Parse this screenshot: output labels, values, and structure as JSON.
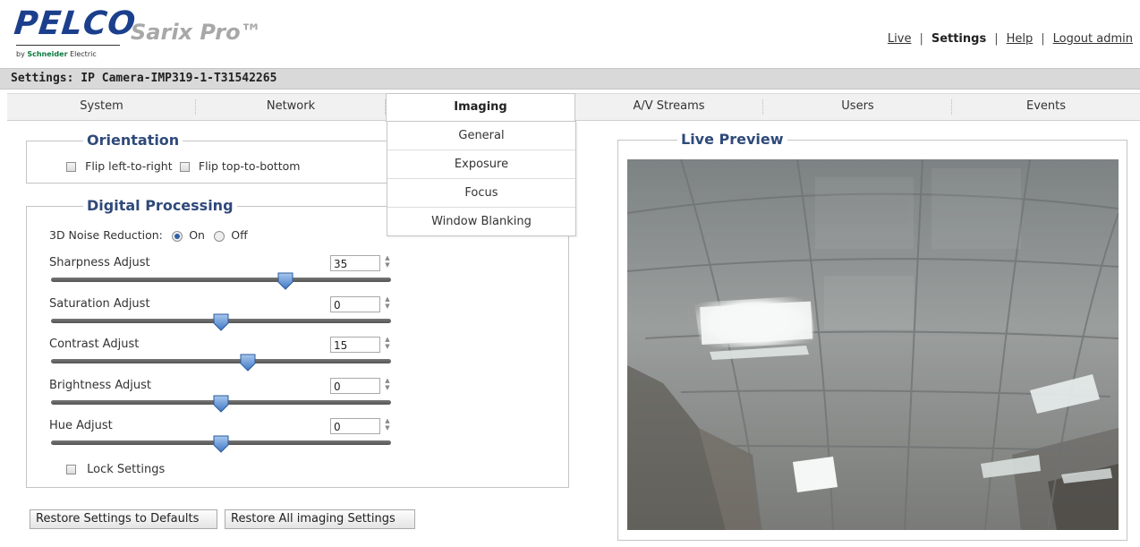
{
  "header": {
    "brand": "PELCO",
    "product": "Sarix Pro™",
    "byline_prefix": "by",
    "byline_brand": "Schneider",
    "byline_suffix": "Electric",
    "links": {
      "live": "Live",
      "settings": "Settings",
      "help": "Help",
      "logout": "Logout admin",
      "separator": "|"
    }
  },
  "titlebar": {
    "text": "Settings: IP Camera-IMP319-1-T31542265"
  },
  "tabs": [
    "System",
    "Network",
    "Imaging",
    "A/V Streams",
    "Users",
    "Events"
  ],
  "active_tab": "Imaging",
  "dropdown": [
    "General",
    "Exposure",
    "Focus",
    "Window Blanking"
  ],
  "orientation": {
    "legend": "Orientation",
    "flip_lr": "Flip left-to-right",
    "flip_tb": "Flip top-to-bottom",
    "flip_lr_checked": false,
    "flip_tb_checked": false
  },
  "digital": {
    "legend": "Digital Processing",
    "noise_label": "3D Noise Reduction:",
    "noise_on": "On",
    "noise_off": "Off",
    "noise_value": "On",
    "sliders": [
      {
        "label": "Sharpness Adjust",
        "value": "35",
        "level": 0.69
      },
      {
        "label": "Saturation Adjust",
        "value": "0",
        "level": 0.5
      },
      {
        "label": "Contrast Adjust",
        "value": "15",
        "level": 0.58
      },
      {
        "label": "Brightness Adjust",
        "value": "0",
        "level": 0.5
      },
      {
        "label": "Hue Adjust",
        "value": "0",
        "level": 0.5
      }
    ],
    "lock_label": "Lock Settings",
    "lock_checked": false
  },
  "buttons": {
    "restore_defaults": "Restore Settings to Defaults",
    "restore_imaging": "Restore All imaging Settings"
  },
  "preview": {
    "legend": "Live Preview"
  },
  "colors": {
    "legend": "#2f4a7a",
    "brand": "#1b3f8c",
    "product": "#a8a8a8"
  }
}
